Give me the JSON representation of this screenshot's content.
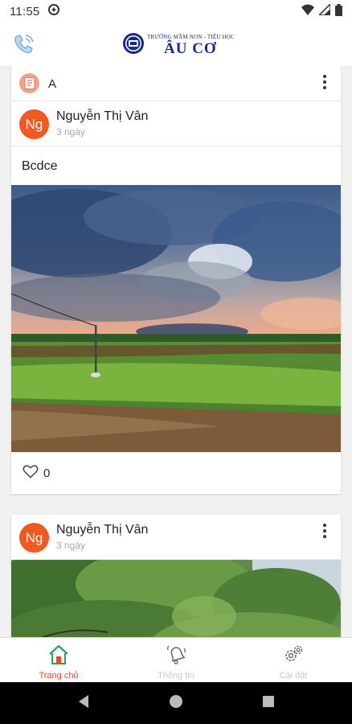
{
  "status_bar": {
    "time": "11:55"
  },
  "header": {
    "logo_small_text": "TRƯỜNG MẦM NON - TIỂU HỌC",
    "logo_big_text": "ÂU CƠ"
  },
  "posts": [
    {
      "group": "A",
      "author_initials": "Ng",
      "author": "Nguyễn Thị Vân",
      "time": "3 ngày",
      "text": "Bcdce",
      "likes": "0"
    },
    {
      "author_initials": "Ng",
      "author": "Nguyễn Thị Vân",
      "time": "3 ngày"
    }
  ],
  "bottom_nav": {
    "items": [
      {
        "label": "Trang chủ",
        "active": true
      },
      {
        "label": "Thông tin",
        "active": false
      },
      {
        "label": "Cài đặt",
        "active": false
      }
    ]
  },
  "colors": {
    "accent": "#e84a2a",
    "avatar": "#f05a22",
    "logo_blue": "#1a2a8c",
    "active_icon": "#2e9e5b"
  }
}
